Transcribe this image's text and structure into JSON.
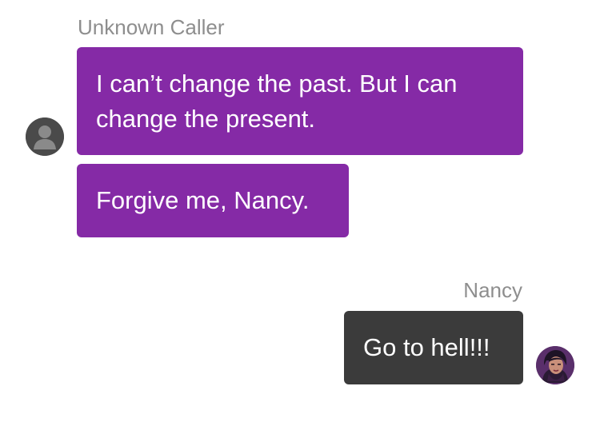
{
  "conversation": {
    "incoming": {
      "sender": "Unknown Caller",
      "avatar_icon": "default-user-avatar-icon",
      "messages": [
        "I can’t change the past. But I can change the present.",
        "Forgive me, Nancy."
      ]
    },
    "outgoing": {
      "sender": "Nancy",
      "avatar_icon": "nancy-portrait-avatar",
      "messages": [
        "Go to hell!!!"
      ]
    }
  },
  "colors": {
    "incoming_bubble": "#852aa6",
    "outgoing_bubble": "#3b3b3b",
    "sender_name": "#8e8e8e",
    "background": "#ffffff"
  }
}
